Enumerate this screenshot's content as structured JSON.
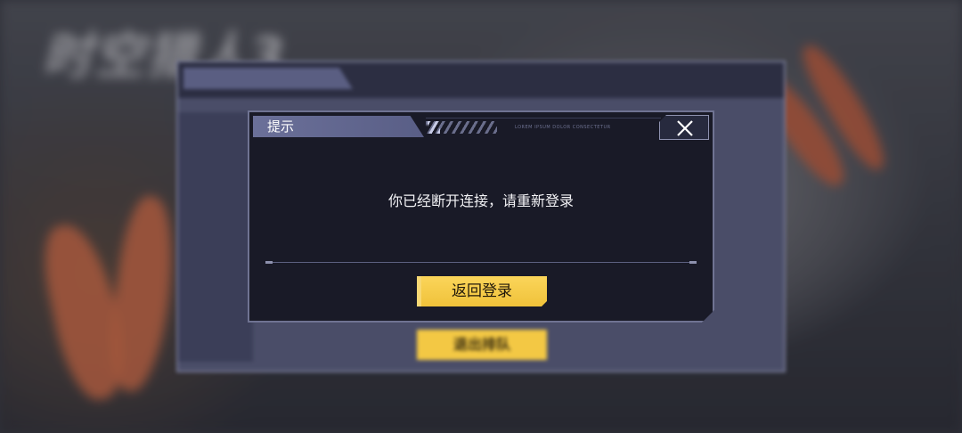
{
  "background": {
    "game_title": "时空猎人3",
    "top_banner": "",
    "underlying_window": {
      "tab_label": "",
      "secondary_button_label": "退出排队"
    }
  },
  "dialog": {
    "title": "提示",
    "message": "你已经断开连接，请重新登录",
    "close_icon": "close-x-icon",
    "primary_button_label": "返回登录",
    "header_note": "LOREM IPSUM DOLOR CONSECTETUR"
  },
  "colors": {
    "accent_yellow": "#f3c844",
    "dialog_bg": "#191a27",
    "tab_purple": "#6b7099"
  }
}
